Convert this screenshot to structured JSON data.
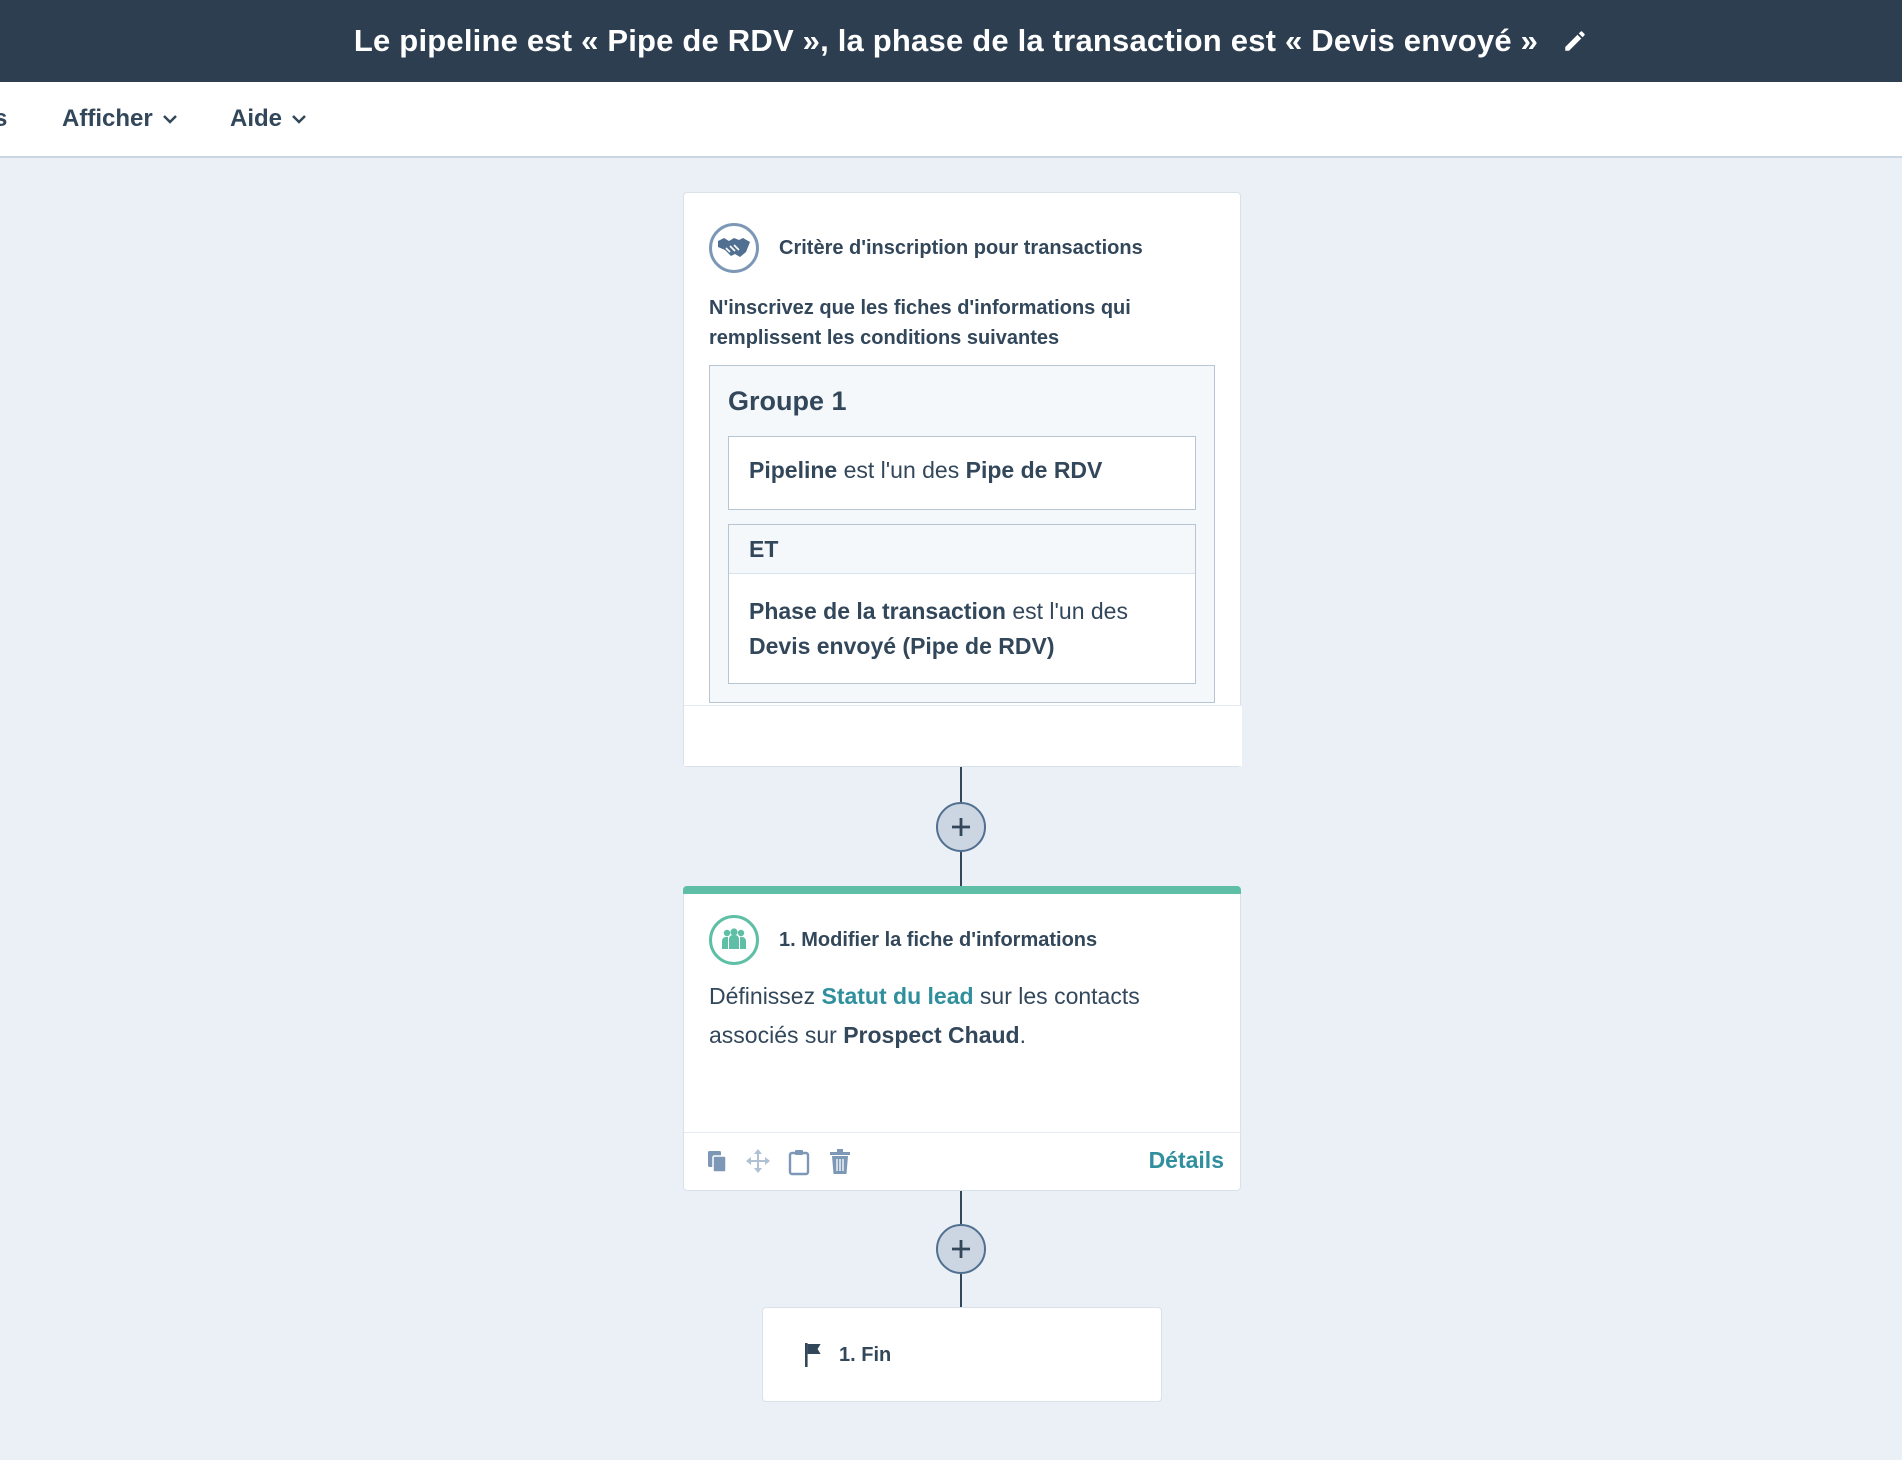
{
  "header": {
    "title": "Le pipeline est « Pipe de RDV », la phase de la transaction est « Devis envoyé »",
    "edit_icon": "pencil-icon"
  },
  "menu": {
    "cut_label": "s",
    "items": [
      {
        "label": "Afficher",
        "icon": "chevron-down-icon"
      },
      {
        "label": "Aide",
        "icon": "chevron-down-icon"
      }
    ]
  },
  "trigger": {
    "icon": "handshake-icon",
    "title": "Critère d'inscription pour transactions",
    "description": "N'inscrivez que les fiches d'informations qui remplissent les conditions suivantes",
    "group": {
      "title": "Groupe 1",
      "conditions": [
        {
          "property": "Pipeline",
          "operator": " est l'un des ",
          "value": "Pipe de RDV"
        },
        {
          "property": "Phase de la transaction",
          "operator": " est l'un des ",
          "value": "Devis envoyé (Pipe de RDV)"
        }
      ],
      "and_label": "ET"
    }
  },
  "action": {
    "icon": "people-icon",
    "title": "1. Modifier la fiche d'informations",
    "text_before": "Définissez ",
    "property_link": "Statut du lead",
    "text_middle": " sur les contacts associés sur ",
    "value": "Prospect Chaud",
    "text_after": ".",
    "details_label": "Détails",
    "accent_color": "#5fbfa6"
  },
  "end": {
    "icon": "flag-icon",
    "label": "1. Fin"
  }
}
